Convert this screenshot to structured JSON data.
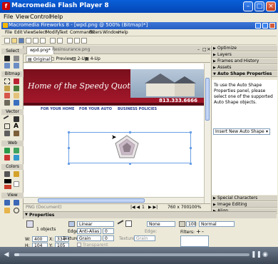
{
  "player": {
    "title": "Macromedia Flash Player 8",
    "menu": [
      "File",
      "View",
      "Control",
      "Help"
    ],
    "progress": 0.02
  },
  "fireworks": {
    "title": "Macromedia Fireworks 8 - [wpd.png @ 500% (Bitmap)*]",
    "menu": [
      "File",
      "Edit",
      "View",
      "Select",
      "Modify",
      "Text",
      "Commands",
      "Filters",
      "Window",
      "Help"
    ]
  },
  "tools": {
    "sections": [
      "Select",
      "Bitmap",
      "Vector",
      "Web",
      "Colors",
      "View"
    ]
  },
  "document": {
    "tabs": [
      "wpd.png*",
      "Resinsurance.png"
    ],
    "views": [
      "Original",
      "Preview",
      "2-Up",
      "4-Up"
    ],
    "banner_title": "Home of the Speedy Quote",
    "phone": "813.333.6666",
    "nav": [
      "FOR YOUR HOME",
      "FOR YOUR AUTO",
      "BUSINESS POLICIES"
    ],
    "status_left": "PNG (Document)",
    "status_size": "760 x 700",
    "status_zoom": "100%",
    "page_num": "1"
  },
  "panels": {
    "items_top": [
      "Optimize",
      "Layers",
      "Frames and History",
      "Assets"
    ],
    "active": "Auto Shape Properties",
    "active_text": "To use the Auto Shape Properties panel, please select one of the supported Auto Shape objects.",
    "insert_label": "Insert New Auto Shape",
    "items_bottom": [
      "Special Characters",
      "Image Editing",
      "Align"
    ]
  },
  "properties": {
    "title": "Properties",
    "objects": "1 objects",
    "fill_type": "Linear",
    "edge_label": "Edge:",
    "edge_value": "Anti-Alias",
    "edge_amount": "0",
    "texture_label": "Texture:",
    "texture_value": "Grain",
    "texture_amount": "0",
    "transparent": "Transparent",
    "stroke_value": "None",
    "stroke_edge_label": "Edge:",
    "stroke_texture_label": "Texture:",
    "stroke_texture_value": "Grain",
    "opacity": "100",
    "blend": "Normal",
    "filters_label": "Filters:",
    "w_label": "W:",
    "w_value": "400",
    "x_label": "X:",
    "x_value": "334",
    "h_label": "H:",
    "h_value": "104",
    "y_label": "Y:",
    "y_value": "105"
  }
}
